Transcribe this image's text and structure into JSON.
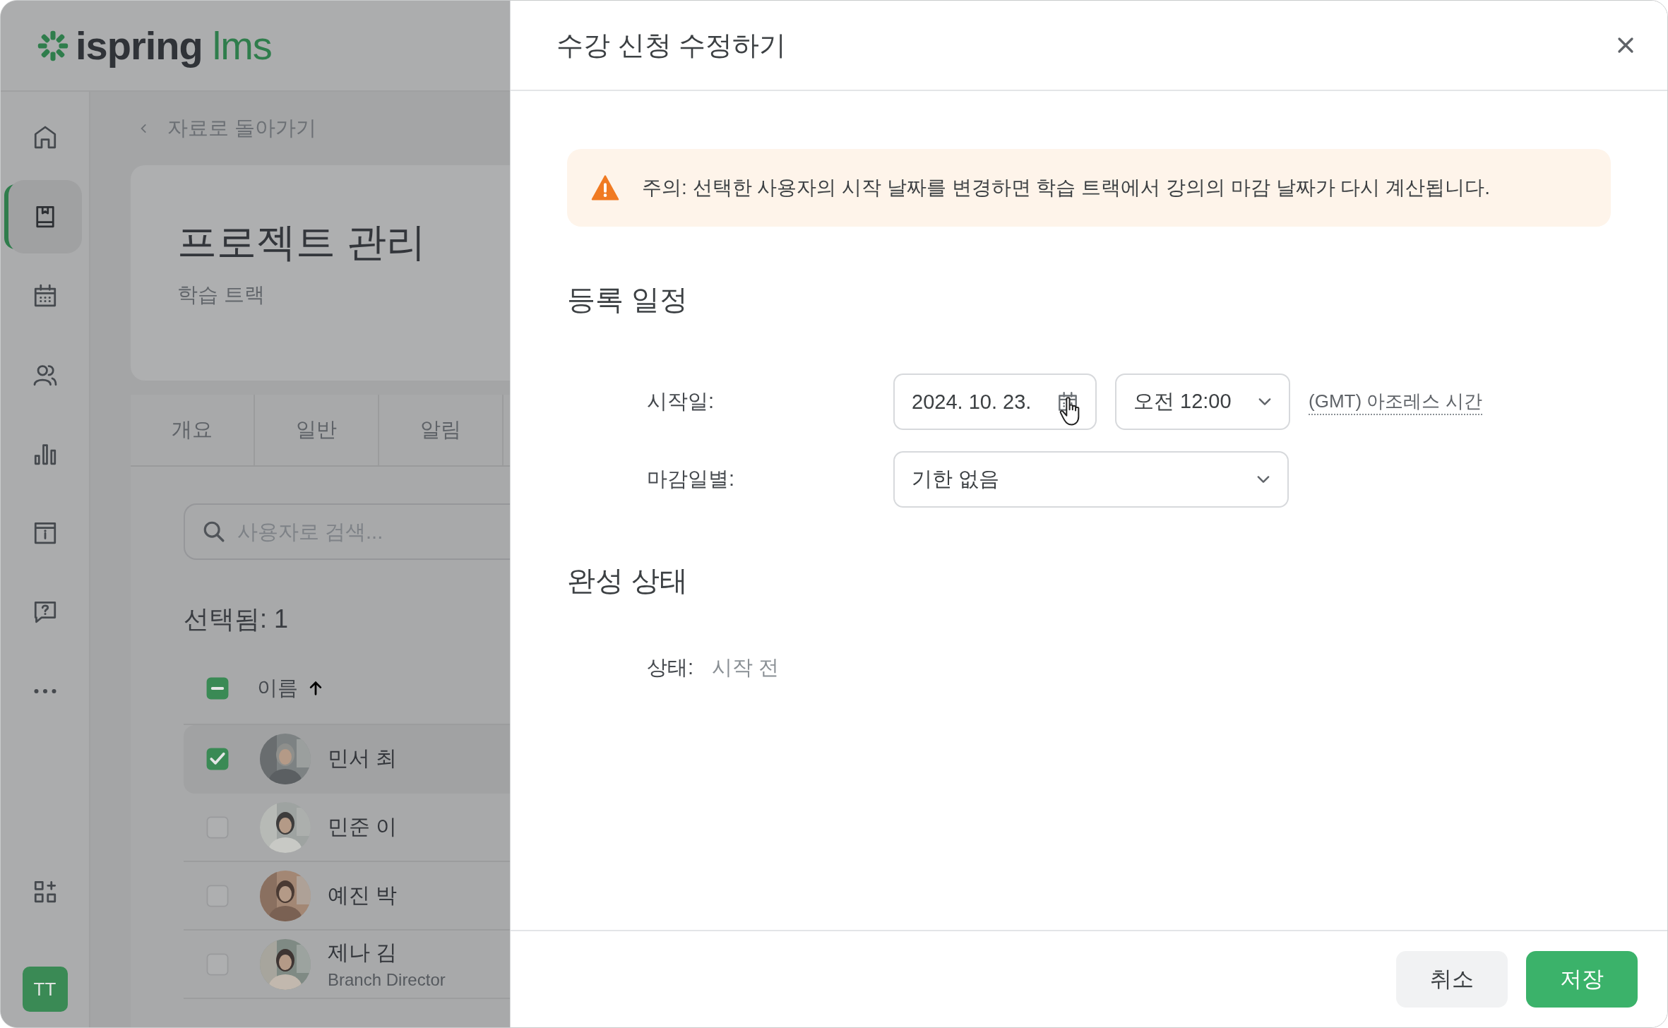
{
  "app": {
    "logo": {
      "word": "ispring",
      "accent": "lms"
    },
    "sidebar": {
      "items": [
        {
          "kind": "home",
          "selected": false
        },
        {
          "kind": "book",
          "selected": true
        },
        {
          "kind": "calendar",
          "selected": false
        },
        {
          "kind": "people",
          "selected": false
        },
        {
          "kind": "chart",
          "selected": false
        },
        {
          "kind": "info",
          "selected": false
        },
        {
          "kind": "help",
          "selected": false
        },
        {
          "kind": "more",
          "selected": false
        }
      ],
      "bottom": [
        {
          "kind": "apps"
        }
      ],
      "avatar": "TT"
    },
    "back_link": "자료로 돌아가기",
    "course": {
      "title": "프로젝트 관리",
      "subtitle": "학습 트랙"
    },
    "tabs": [
      {
        "label": "개요",
        "selected": false
      },
      {
        "label": "일반",
        "selected": false
      },
      {
        "label": "알림",
        "selected": false
      }
    ],
    "search": {
      "placeholder": "사용자로 검색..."
    },
    "selected_count": "선택됨: 1",
    "table": {
      "select_all": {
        "checked": false,
        "indeterminate": true
      },
      "columns": [
        {
          "label": "이름",
          "sorted": true,
          "ascending": true
        }
      ],
      "rows": [
        {
          "name": "민서 최",
          "checked": true,
          "selected": true
        },
        {
          "name": "민준 이",
          "checked": false,
          "selected": false
        },
        {
          "name": "예진 박",
          "checked": false,
          "selected": false
        },
        {
          "name": "제나 김",
          "subtitle": "Branch Director",
          "checked": false,
          "selected": false
        }
      ]
    }
  },
  "dialog": {
    "title": "수강 신청 수정하기",
    "warning": "주의: 선택한 사용자의 시작 날짜를 변경하면 학습 트랙에서 강의의 마감 날짜가 다시 계산됩니다.",
    "sections": [
      {
        "heading": "등록 일정",
        "fields": [
          {
            "kind": "schedule",
            "label": "시작일:",
            "date": "2024. 10. 23.",
            "time": "오전 12:00",
            "timezone": "(GMT) 아조레스 시간"
          },
          {
            "kind": "select",
            "label": "마감일별:",
            "value": "기한 없음"
          }
        ]
      },
      {
        "heading": "완성 상태",
        "fields": [
          {
            "kind": "text",
            "label": "상태:",
            "value": "시작 전"
          }
        ]
      }
    ],
    "buttons": [
      {
        "label": "취소",
        "kind": "secondary"
      },
      {
        "label": "저장",
        "kind": "primary"
      }
    ]
  }
}
